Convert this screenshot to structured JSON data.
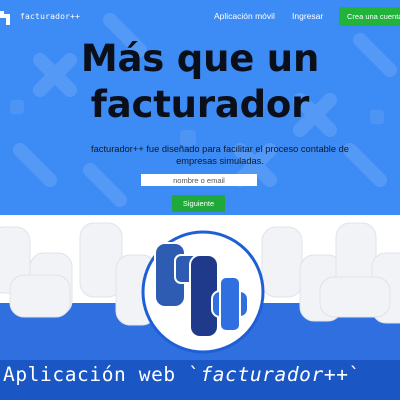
{
  "navbar": {
    "logo_text": "facturador++",
    "link_app": "Aplicación móvil",
    "link_login": "Ingresar",
    "cta_label": "Crea una cuenta"
  },
  "hero": {
    "headline_line1": "Más que un",
    "headline_line2": "facturador",
    "subtitle": "facturador++ fue diseñado para facilitar el proceso contable de empresas simuladas.",
    "email_placeholder": "nombre o email",
    "next_label": "Siguiente"
  },
  "banner": {
    "caption_prefix": "Aplicación web `",
    "caption_name": "facturador++",
    "caption_suffix": "`"
  },
  "colors": {
    "hero_blue": "#3d8bf5",
    "cta_green": "#22b33b",
    "banner_blue": "#2f6fe0",
    "logo_navy": "#1f3a8a"
  }
}
